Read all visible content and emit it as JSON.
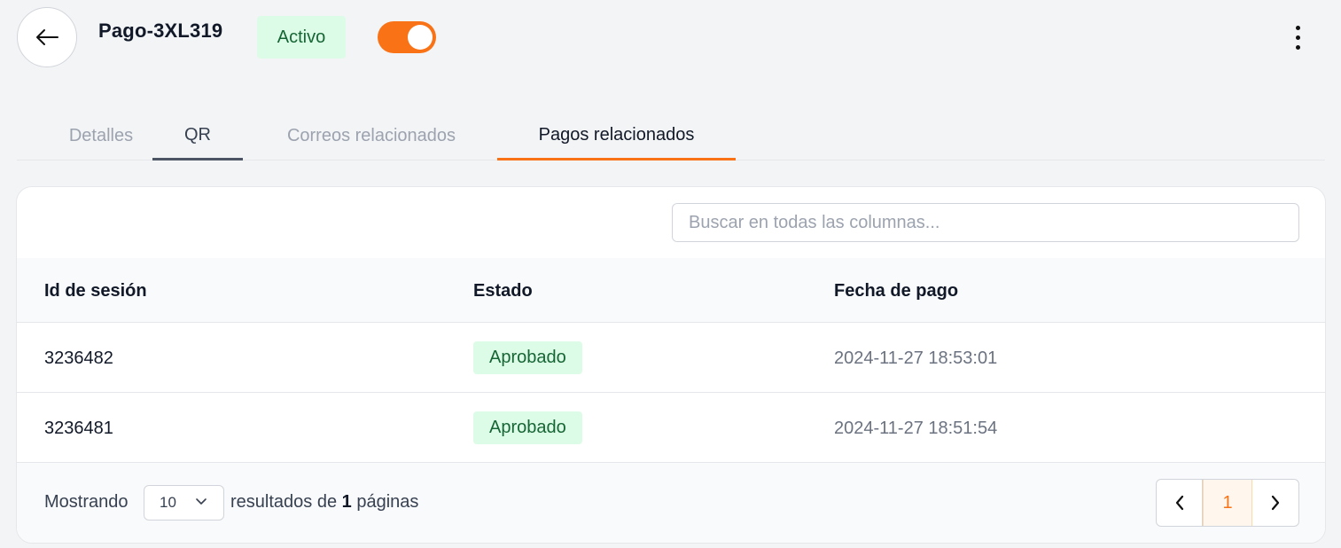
{
  "header": {
    "title": "Pago-3XL319",
    "status": "Activo",
    "toggle_on": true,
    "accent_color": "#f97316"
  },
  "tabs": [
    {
      "label": "Detalles"
    },
    {
      "label": "QR"
    },
    {
      "label": "Correos relacionados"
    },
    {
      "label": "Pagos relacionados",
      "active": true
    }
  ],
  "search": {
    "placeholder": "Buscar en todas las columnas...",
    "value": ""
  },
  "table": {
    "columns": [
      "Id de sesión",
      "Estado",
      "Fecha de pago"
    ],
    "rows": [
      {
        "id": "3236482",
        "estado": "Aprobado",
        "fecha": "2024-11-27 18:53:01"
      },
      {
        "id": "3236481",
        "estado": "Aprobado",
        "fecha": "2024-11-27 18:51:54"
      }
    ]
  },
  "footer": {
    "showing_label": "Mostrando",
    "page_size": "10",
    "results_label": "resultados de",
    "page_count": "1",
    "pages_label": "páginas",
    "current_page": "1"
  }
}
